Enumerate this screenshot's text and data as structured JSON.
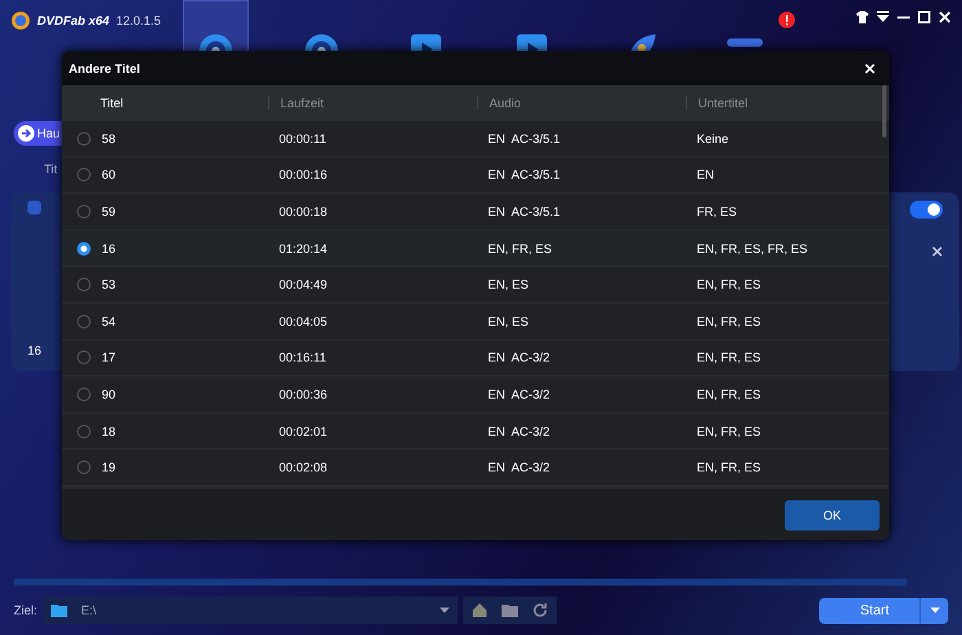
{
  "app": {
    "logo": "DVDFab",
    "edition": "x64",
    "version": "12.0.1.5"
  },
  "toolbar": [
    {
      "kind": "disc",
      "selected": true
    },
    {
      "kind": "disc",
      "selected": false
    },
    {
      "kind": "film",
      "selected": false
    },
    {
      "kind": "film",
      "selected": false
    },
    {
      "kind": "rocket",
      "selected": false
    },
    {
      "kind": "bars",
      "selected": false
    }
  ],
  "main": {
    "back_button": "Hau",
    "column_label": "Tit",
    "card": {
      "title_number": "16",
      "toggle_on": true
    }
  },
  "dialog": {
    "title": "Andere Titel",
    "columns": [
      "Titel",
      "Laufzeit",
      "Audio",
      "Untertitel"
    ],
    "rows": [
      {
        "titel": "58",
        "laufzeit": "00:00:11",
        "audio": "EN  AC-3/5.1",
        "untertitel": "Keine",
        "selected": false
      },
      {
        "titel": "60",
        "laufzeit": "00:00:16",
        "audio": "EN  AC-3/5.1",
        "untertitel": "EN",
        "selected": false
      },
      {
        "titel": "59",
        "laufzeit": "00:00:18",
        "audio": "EN  AC-3/5.1",
        "untertitel": "FR, ES",
        "selected": false
      },
      {
        "titel": "16",
        "laufzeit": "01:20:14",
        "audio": "EN, FR, ES",
        "untertitel": "EN, FR, ES, FR, ES",
        "selected": true
      },
      {
        "titel": "53",
        "laufzeit": "00:04:49",
        "audio": "EN, ES",
        "untertitel": "EN, FR, ES",
        "selected": false
      },
      {
        "titel": "54",
        "laufzeit": "00:04:05",
        "audio": "EN, ES",
        "untertitel": "EN, FR, ES",
        "selected": false
      },
      {
        "titel": "17",
        "laufzeit": "00:16:11",
        "audio": "EN  AC-3/2",
        "untertitel": "EN, FR, ES",
        "selected": false
      },
      {
        "titel": "90",
        "laufzeit": "00:00:36",
        "audio": "EN  AC-3/2",
        "untertitel": "EN, FR, ES",
        "selected": false
      },
      {
        "titel": "18",
        "laufzeit": "00:02:01",
        "audio": "EN  AC-3/2",
        "untertitel": "EN, FR, ES",
        "selected": false
      },
      {
        "titel": "19",
        "laufzeit": "00:02:08",
        "audio": "EN  AC-3/2",
        "untertitel": "EN, FR, ES",
        "selected": false
      }
    ],
    "ok_button": "OK"
  },
  "footer": {
    "label": "Ziel:",
    "path": "E:\\",
    "start_button": "Start"
  }
}
